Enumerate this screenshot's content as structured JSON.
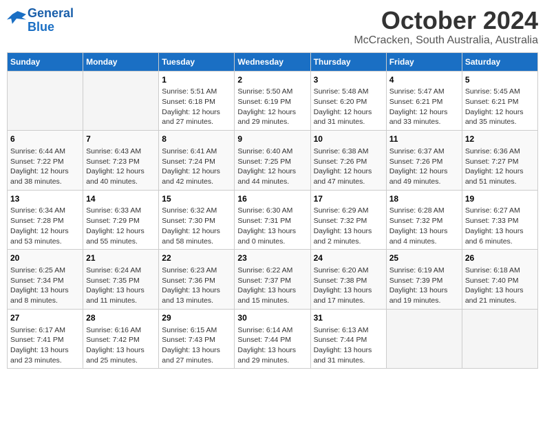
{
  "header": {
    "logo_line1": "General",
    "logo_line2": "Blue",
    "month": "October 2024",
    "location": "McCracken, South Australia, Australia"
  },
  "days_of_week": [
    "Sunday",
    "Monday",
    "Tuesday",
    "Wednesday",
    "Thursday",
    "Friday",
    "Saturday"
  ],
  "weeks": [
    [
      {
        "day": "",
        "info": ""
      },
      {
        "day": "",
        "info": ""
      },
      {
        "day": "1",
        "info": "Sunrise: 5:51 AM\nSunset: 6:18 PM\nDaylight: 12 hours\nand 27 minutes."
      },
      {
        "day": "2",
        "info": "Sunrise: 5:50 AM\nSunset: 6:19 PM\nDaylight: 12 hours\nand 29 minutes."
      },
      {
        "day": "3",
        "info": "Sunrise: 5:48 AM\nSunset: 6:20 PM\nDaylight: 12 hours\nand 31 minutes."
      },
      {
        "day": "4",
        "info": "Sunrise: 5:47 AM\nSunset: 6:21 PM\nDaylight: 12 hours\nand 33 minutes."
      },
      {
        "day": "5",
        "info": "Sunrise: 5:45 AM\nSunset: 6:21 PM\nDaylight: 12 hours\nand 35 minutes."
      }
    ],
    [
      {
        "day": "6",
        "info": "Sunrise: 6:44 AM\nSunset: 7:22 PM\nDaylight: 12 hours\nand 38 minutes."
      },
      {
        "day": "7",
        "info": "Sunrise: 6:43 AM\nSunset: 7:23 PM\nDaylight: 12 hours\nand 40 minutes."
      },
      {
        "day": "8",
        "info": "Sunrise: 6:41 AM\nSunset: 7:24 PM\nDaylight: 12 hours\nand 42 minutes."
      },
      {
        "day": "9",
        "info": "Sunrise: 6:40 AM\nSunset: 7:25 PM\nDaylight: 12 hours\nand 44 minutes."
      },
      {
        "day": "10",
        "info": "Sunrise: 6:38 AM\nSunset: 7:26 PM\nDaylight: 12 hours\nand 47 minutes."
      },
      {
        "day": "11",
        "info": "Sunrise: 6:37 AM\nSunset: 7:26 PM\nDaylight: 12 hours\nand 49 minutes."
      },
      {
        "day": "12",
        "info": "Sunrise: 6:36 AM\nSunset: 7:27 PM\nDaylight: 12 hours\nand 51 minutes."
      }
    ],
    [
      {
        "day": "13",
        "info": "Sunrise: 6:34 AM\nSunset: 7:28 PM\nDaylight: 12 hours\nand 53 minutes."
      },
      {
        "day": "14",
        "info": "Sunrise: 6:33 AM\nSunset: 7:29 PM\nDaylight: 12 hours\nand 55 minutes."
      },
      {
        "day": "15",
        "info": "Sunrise: 6:32 AM\nSunset: 7:30 PM\nDaylight: 12 hours\nand 58 minutes."
      },
      {
        "day": "16",
        "info": "Sunrise: 6:30 AM\nSunset: 7:31 PM\nDaylight: 13 hours\nand 0 minutes."
      },
      {
        "day": "17",
        "info": "Sunrise: 6:29 AM\nSunset: 7:32 PM\nDaylight: 13 hours\nand 2 minutes."
      },
      {
        "day": "18",
        "info": "Sunrise: 6:28 AM\nSunset: 7:32 PM\nDaylight: 13 hours\nand 4 minutes."
      },
      {
        "day": "19",
        "info": "Sunrise: 6:27 AM\nSunset: 7:33 PM\nDaylight: 13 hours\nand 6 minutes."
      }
    ],
    [
      {
        "day": "20",
        "info": "Sunrise: 6:25 AM\nSunset: 7:34 PM\nDaylight: 13 hours\nand 8 minutes."
      },
      {
        "day": "21",
        "info": "Sunrise: 6:24 AM\nSunset: 7:35 PM\nDaylight: 13 hours\nand 11 minutes."
      },
      {
        "day": "22",
        "info": "Sunrise: 6:23 AM\nSunset: 7:36 PM\nDaylight: 13 hours\nand 13 minutes."
      },
      {
        "day": "23",
        "info": "Sunrise: 6:22 AM\nSunset: 7:37 PM\nDaylight: 13 hours\nand 15 minutes."
      },
      {
        "day": "24",
        "info": "Sunrise: 6:20 AM\nSunset: 7:38 PM\nDaylight: 13 hours\nand 17 minutes."
      },
      {
        "day": "25",
        "info": "Sunrise: 6:19 AM\nSunset: 7:39 PM\nDaylight: 13 hours\nand 19 minutes."
      },
      {
        "day": "26",
        "info": "Sunrise: 6:18 AM\nSunset: 7:40 PM\nDaylight: 13 hours\nand 21 minutes."
      }
    ],
    [
      {
        "day": "27",
        "info": "Sunrise: 6:17 AM\nSunset: 7:41 PM\nDaylight: 13 hours\nand 23 minutes."
      },
      {
        "day": "28",
        "info": "Sunrise: 6:16 AM\nSunset: 7:42 PM\nDaylight: 13 hours\nand 25 minutes."
      },
      {
        "day": "29",
        "info": "Sunrise: 6:15 AM\nSunset: 7:43 PM\nDaylight: 13 hours\nand 27 minutes."
      },
      {
        "day": "30",
        "info": "Sunrise: 6:14 AM\nSunset: 7:44 PM\nDaylight: 13 hours\nand 29 minutes."
      },
      {
        "day": "31",
        "info": "Sunrise: 6:13 AM\nSunset: 7:44 PM\nDaylight: 13 hours\nand 31 minutes."
      },
      {
        "day": "",
        "info": ""
      },
      {
        "day": "",
        "info": ""
      }
    ]
  ]
}
